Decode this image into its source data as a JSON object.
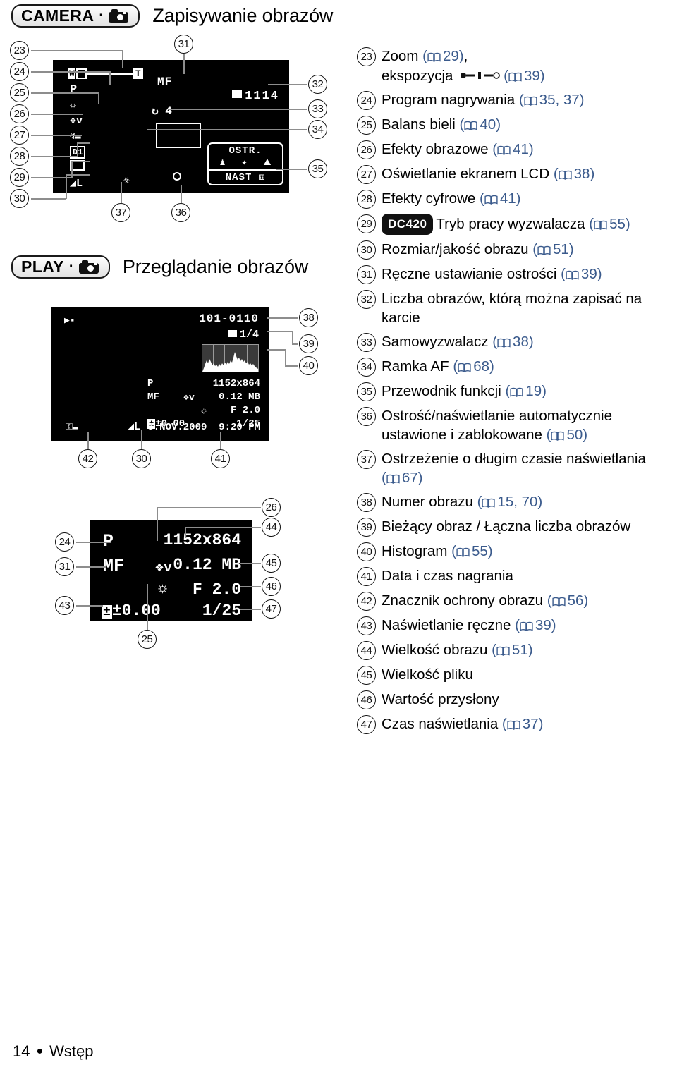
{
  "sections": {
    "camera": {
      "badge_label": "CAMERA",
      "badge_dot": "·",
      "title": "Zapisywanie obrazów"
    },
    "play": {
      "badge_label": "PLAY",
      "badge_dot": "·",
      "title": "Przeglądanie obrazów"
    }
  },
  "camera_screen": {
    "zoom_w": "W",
    "zoom_t": "T",
    "program": "P",
    "manual_focus": "MF",
    "image_count": "1114",
    "selftimer": "4",
    "quality": "L",
    "drive": "1",
    "guide_top": "OSTR.",
    "guide_bottom": "NAST",
    "callouts": [
      "23",
      "24",
      "25",
      "26",
      "27",
      "28",
      "29",
      "30",
      "31",
      "32",
      "33",
      "34",
      "35",
      "36",
      "37"
    ]
  },
  "play_screen": {
    "file_number": "101-0110",
    "frame_counter": "1/4",
    "program": "P",
    "resolution": "1152x864",
    "manual_focus": "MF",
    "filesize": "0.12 MB",
    "aperture": "F 2.0",
    "exposure_comp": "±0.00",
    "shutter": "1/25",
    "quality": "L",
    "date": "3.NOV.2009",
    "time": "9:20 PM",
    "callouts": [
      "38",
      "39",
      "40",
      "42",
      "30",
      "41"
    ]
  },
  "detail_screen": {
    "program": "P",
    "resolution": "1152x864",
    "manual_focus": "MF",
    "filesize": "0.12 MB",
    "aperture": "F 2.0",
    "exposure_comp": "±0.00",
    "shutter": "1/25",
    "callouts": [
      "24",
      "31",
      "43",
      "25",
      "26",
      "44",
      "45",
      "46",
      "47"
    ]
  },
  "legend": [
    {
      "n": "23",
      "text": "Zoom ",
      "ref1": "29",
      "tail": ",",
      "line2_pre": "ekspozycja ",
      "line2_icon": "exposure-slider",
      "line2_ref": "39"
    },
    {
      "n": "24",
      "text": "Program nagrywania ",
      "ref1": "35, 37"
    },
    {
      "n": "25",
      "text": "Balans bieli ",
      "ref1": "40"
    },
    {
      "n": "26",
      "text": "Efekty obrazowe ",
      "ref1": "41"
    },
    {
      "n": "27",
      "text": "Oświetlanie ekranem LCD ",
      "ref1": "38"
    },
    {
      "n": "28",
      "text": "Efekty cyfrowe ",
      "ref1": "41"
    },
    {
      "n": "29",
      "badge": "DC420",
      "text": "Tryb pracy wyzwalacza ",
      "ref1": "55"
    },
    {
      "n": "30",
      "text": "Rozmiar/jakość obrazu ",
      "ref1": "51"
    },
    {
      "n": "31",
      "text": "Ręczne ustawianie ostrości ",
      "ref1": "39"
    },
    {
      "n": "32",
      "text": "Liczba obrazów, którą można zapisać na karcie"
    },
    {
      "n": "33",
      "text": "Samowyzwalacz ",
      "ref1": "38"
    },
    {
      "n": "34",
      "text": "Ramka AF ",
      "ref1": "68"
    },
    {
      "n": "35",
      "text": "Przewodnik funkcji ",
      "ref1": "19"
    },
    {
      "n": "36",
      "text": "Ostrość/naświetlanie automatycznie ustawione i zablokowane ",
      "ref1": "50"
    },
    {
      "n": "37",
      "text": "Ostrzeżenie o długim czasie naświetlania ",
      "ref1": "67"
    },
    {
      "n": "38",
      "text": "Numer obrazu ",
      "ref1": "15, 70"
    },
    {
      "n": "39",
      "text": "Bieżący obraz / Łączna liczba obrazów"
    },
    {
      "n": "40",
      "text": "Histogram ",
      "ref1": "55"
    },
    {
      "n": "41",
      "text": "Data i czas nagrania"
    },
    {
      "n": "42",
      "text": "Znacznik ochrony obrazu ",
      "ref1": "56"
    },
    {
      "n": "43",
      "text": "Naświetlanie ręczne ",
      "ref1": "39"
    },
    {
      "n": "44",
      "text": "Wielkość obrazu ",
      "ref1": "51"
    },
    {
      "n": "45",
      "text": "Wielkość pliku"
    },
    {
      "n": "46",
      "text": "Wartość przysłony"
    },
    {
      "n": "47",
      "text": "Czas naświetlania ",
      "ref1": "37"
    }
  ],
  "footer": {
    "page_number": "14",
    "bullet": "●",
    "chapter": "Wstęp"
  },
  "colors": {
    "reference_blue": "#3a5a8c",
    "leader_gray": "#8d8d8d",
    "lcd_black": "#000000"
  }
}
